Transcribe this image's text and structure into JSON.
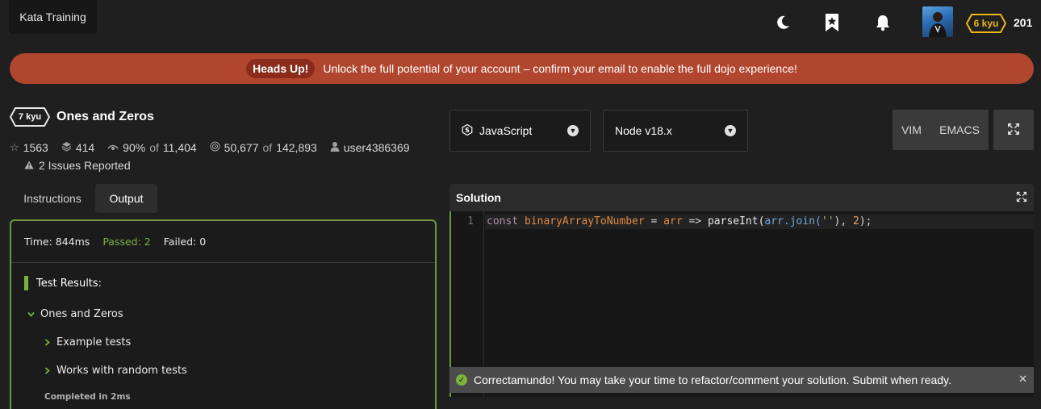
{
  "header": {
    "brand": "Kata Training",
    "icons": [
      "moon-icon",
      "bookmark-icon",
      "bell-icon"
    ],
    "user_rank": "6 kyu",
    "honor": "201"
  },
  "banner": {
    "pill": "Heads Up!",
    "message": "Unlock the full potential of your account – confirm your email to enable the full dojo experience!"
  },
  "kata": {
    "rank": "7 kyu",
    "title": "Ones and Zeros",
    "stats": {
      "stars": "1563",
      "collections": "414",
      "satisfaction": "90%",
      "of_label": "of",
      "satisfaction_total": "11,404",
      "completed": "50,677",
      "completed_total": "142,893",
      "author": "user4386369"
    },
    "issues": "2 Issues Reported"
  },
  "tabs": [
    {
      "label": "Instructions",
      "active": false
    },
    {
      "label": "Output",
      "active": true
    }
  ],
  "output": {
    "time": "Time: 844ms",
    "passed": "Passed: 2",
    "failed": "Failed: 0",
    "results_title": "Test Results:",
    "suite": "Ones and Zeros",
    "groups": [
      "Example tests",
      "Works with random tests"
    ],
    "completed": "Completed in 2ms"
  },
  "editor_controls": {
    "language": "JavaScript",
    "runtime": "Node v18.x",
    "modes": [
      "VIM",
      "EMACS"
    ]
  },
  "solution": {
    "title": "Solution",
    "line_number": "1",
    "code_tokens": {
      "k1": "const",
      "v1": "binaryArrayToNumber",
      "o1": "=",
      "v2": "arr",
      "o2": "=>",
      "f1": "parseInt(",
      "v3": "arr",
      "p1": ".join(",
      "s1": "''",
      "o3": "),",
      "n1": "2",
      "o4": ");"
    }
  },
  "toast": {
    "message": "Correctamundo! You may take your time to refactor/comment your solution. Submit when ready."
  },
  "colors": {
    "background": "#1f1f20",
    "banner": "#b1462e",
    "pass_green": "#7bb23e",
    "rank_yellow": "#ecb613"
  }
}
